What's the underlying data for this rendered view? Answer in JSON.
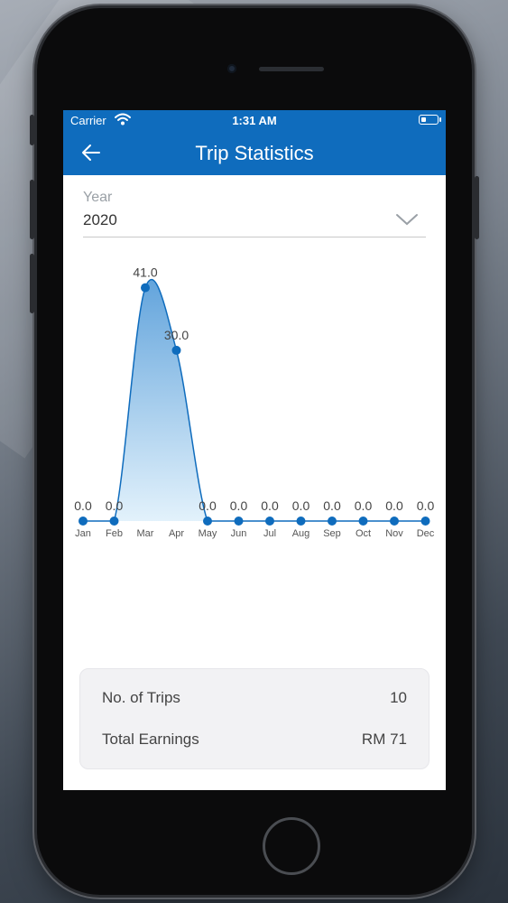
{
  "status_bar": {
    "carrier": "Carrier",
    "time": "1:31 AM"
  },
  "header": {
    "title": "Trip Statistics",
    "back_icon": "arrow-left-icon"
  },
  "year_filter": {
    "label": "Year",
    "value": "2020",
    "dropdown_icon": "chevron-down-icon"
  },
  "chart_data": {
    "type": "area",
    "categories": [
      "Jan",
      "Feb",
      "Mar",
      "Apr",
      "May",
      "Jun",
      "Jul",
      "Aug",
      "Sep",
      "Oct",
      "Nov",
      "Dec"
    ],
    "values": [
      0,
      0,
      41,
      30,
      0,
      0,
      0,
      0,
      0,
      0,
      0,
      0
    ],
    "data_labels": [
      "0.0",
      "0.0",
      "41.0",
      "30.0",
      "0.0",
      "0.0",
      "0.0",
      "0.0",
      "0.0",
      "0.0",
      "0.0",
      "0.0"
    ],
    "ylim": [
      0,
      43
    ],
    "grid": false,
    "color": "#0f6cbd"
  },
  "summary": {
    "trips_label": "No. of Trips",
    "trips_value": "10",
    "earnings_label": "Total Earnings",
    "earnings_value": "RM 71"
  },
  "colors": {
    "primary": "#0f6cbd",
    "card_bg": "#f2f2f4"
  }
}
